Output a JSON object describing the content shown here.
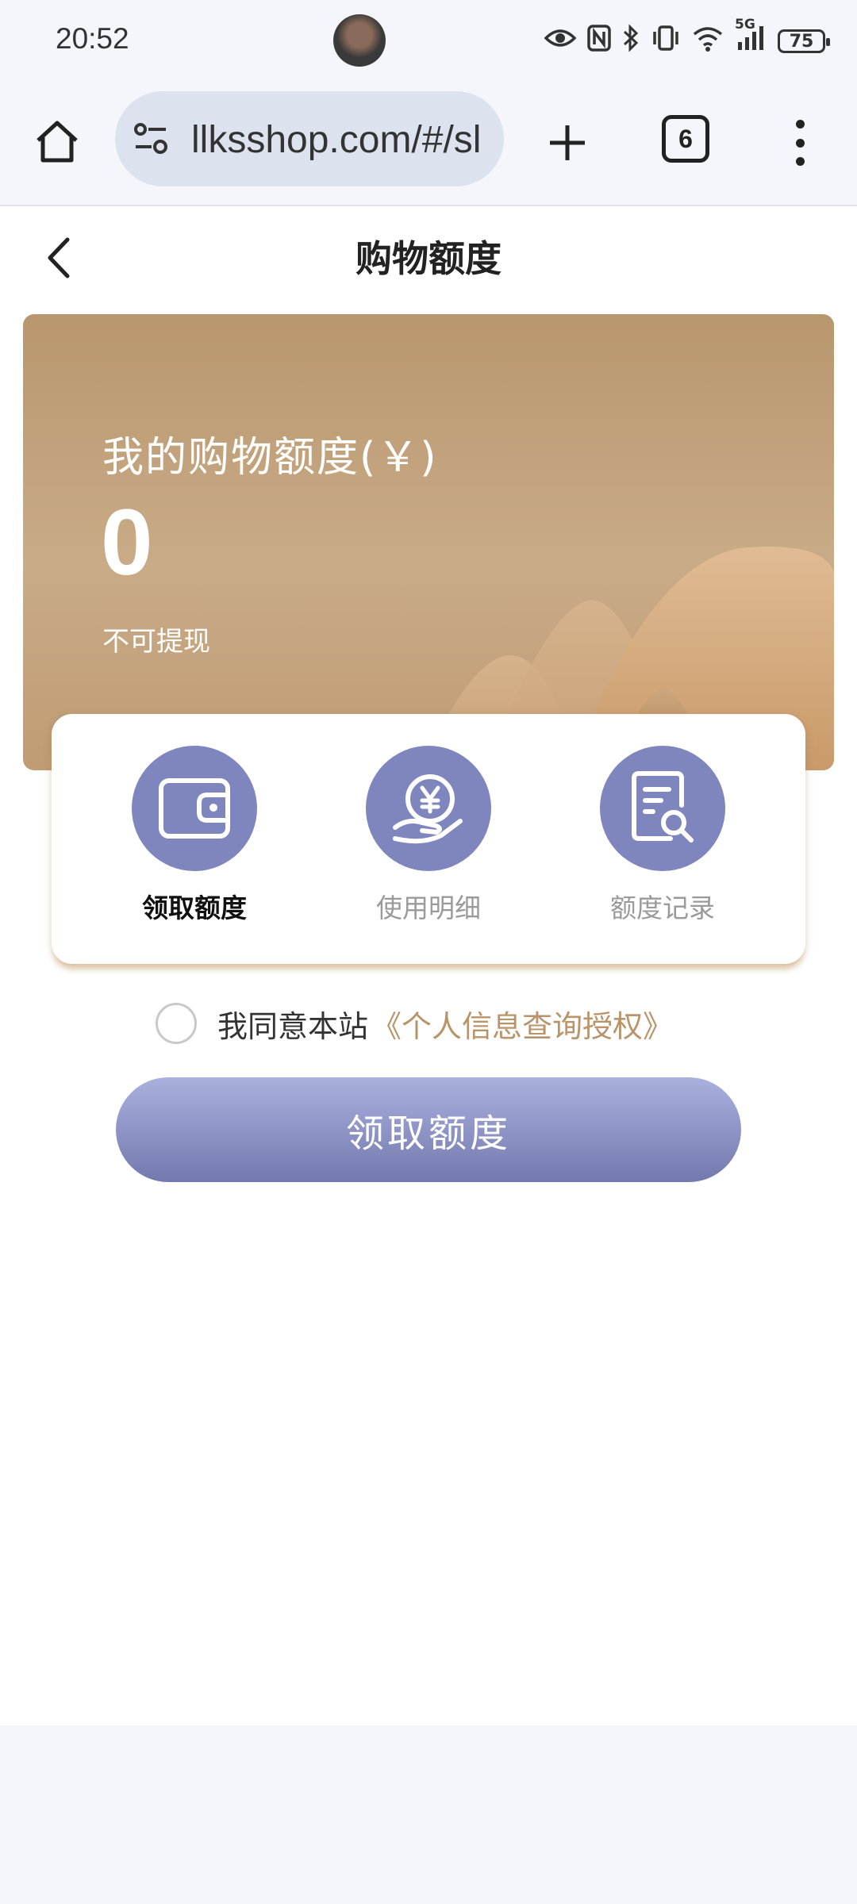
{
  "status_bar": {
    "time": "20:52",
    "network": "5G",
    "battery": "75"
  },
  "browser": {
    "url": "llksshop.com/#/sl",
    "tab_count": "6"
  },
  "header": {
    "title": "购物额度"
  },
  "hero": {
    "label": "我的购物额度(￥)",
    "amount": "0",
    "note": "不可提现"
  },
  "actions": [
    {
      "label": "领取额度",
      "icon": "wallet-icon",
      "active": true
    },
    {
      "label": "使用明细",
      "icon": "yuan-hand-icon",
      "active": false
    },
    {
      "label": "额度记录",
      "icon": "document-search-icon",
      "active": false
    }
  ],
  "agreement": {
    "text": "我同意本站",
    "link": "《个人信息查询授权》"
  },
  "cta": {
    "label": "领取额度"
  },
  "colors": {
    "hero_brown": "#b8976e",
    "accent_purple": "#7e86bd",
    "link_gold": "#b9946a"
  }
}
